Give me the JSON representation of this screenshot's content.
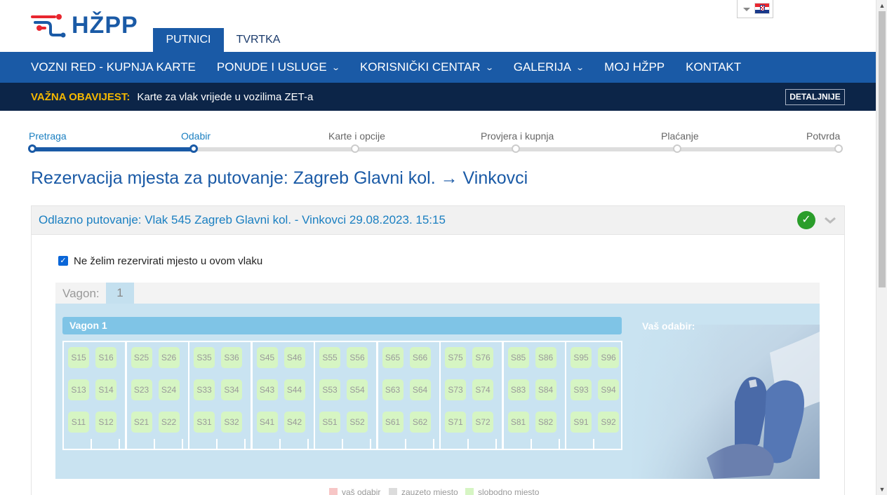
{
  "brand": {
    "logo_text": "HŽPP",
    "logo_icon": "train-track-logo-icon"
  },
  "top_tabs": [
    {
      "label": "PUTNICI",
      "active": true
    },
    {
      "label": "TVRTKA",
      "active": false
    }
  ],
  "language": {
    "flag": "croatia-flag-icon"
  },
  "nav": [
    {
      "label": "VOZNI RED - KUPNJA KARTE",
      "dropdown": false
    },
    {
      "label": "PONUDE I USLUGE",
      "dropdown": true
    },
    {
      "label": "KORISNIČKI CENTAR",
      "dropdown": true
    },
    {
      "label": "GALERIJA",
      "dropdown": true
    },
    {
      "label": "MOJ HŽPP",
      "dropdown": false
    },
    {
      "label": "KONTAKT",
      "dropdown": false
    }
  ],
  "notice": {
    "label": "VAŽNA OBAVIJEST:",
    "text": "Karte za vlak vrijede u vozilima ZET-a",
    "button": "DETALJNIJE"
  },
  "steps": [
    {
      "label": "Pretraga",
      "state": "done"
    },
    {
      "label": "Odabir",
      "state": "current"
    },
    {
      "label": "Karte i opcije",
      "state": "todo"
    },
    {
      "label": "Provjera i kupnja",
      "state": "todo"
    },
    {
      "label": "Plaćanje",
      "state": "todo"
    },
    {
      "label": "Potvrda",
      "state": "todo"
    }
  ],
  "page_title": "Rezervacija mjesta za putovanje: Zagreb Glavni kol. → Vinkovci",
  "journey": {
    "title": "Odlazno putovanje: Vlak 545 Zagreb Glavni kol. - Vinkovci 29.08.2023. 15:15",
    "status_icon": "check-circle-icon",
    "expand_icon": "chevron-down-icon"
  },
  "no_reservation": {
    "label": "Ne želim rezervirati mjesto u ovom vlaku",
    "checked": true
  },
  "wagon_tabs": {
    "label": "Vagon:",
    "tabs": [
      "1"
    ]
  },
  "wagon": {
    "title": "Vagon 1",
    "choice_label": "Vaš odabir:",
    "compartments": [
      {
        "rows": [
          [
            "S15",
            "S16"
          ],
          [
            "S13",
            "S14"
          ],
          [
            "S11",
            "S12"
          ]
        ]
      },
      {
        "rows": [
          [
            "S25",
            "S26"
          ],
          [
            "S23",
            "S24"
          ],
          [
            "S21",
            "S22"
          ]
        ]
      },
      {
        "rows": [
          [
            "S35",
            "S36"
          ],
          [
            "S33",
            "S34"
          ],
          [
            "S31",
            "S32"
          ]
        ]
      },
      {
        "rows": [
          [
            "S45",
            "S46"
          ],
          [
            "S43",
            "S44"
          ],
          [
            "S41",
            "S42"
          ]
        ]
      },
      {
        "rows": [
          [
            "S55",
            "S56"
          ],
          [
            "S53",
            "S54"
          ],
          [
            "S51",
            "S52"
          ]
        ]
      },
      {
        "rows": [
          [
            "S65",
            "S66"
          ],
          [
            "S63",
            "S64"
          ],
          [
            "S61",
            "S62"
          ]
        ]
      },
      {
        "rows": [
          [
            "S75",
            "S76"
          ],
          [
            "S73",
            "S74"
          ],
          [
            "S71",
            "S72"
          ]
        ]
      },
      {
        "rows": [
          [
            "S85",
            "S86"
          ],
          [
            "S83",
            "S84"
          ],
          [
            "S81",
            "S82"
          ]
        ]
      },
      {
        "rows": [
          [
            "S95",
            "S96"
          ],
          [
            "S93",
            "S94"
          ],
          [
            "S91",
            "S92"
          ]
        ]
      }
    ]
  },
  "legend": [
    {
      "label": "vaš odabir",
      "color": "#f7c6c6"
    },
    {
      "label": "zauzeto mjesto",
      "color": "#dcdcdc"
    },
    {
      "label": "slobodno mjesto",
      "color": "#d6f5c3"
    }
  ],
  "colors": {
    "primary": "#1a5aa6",
    "notice_bg": "#0c2548",
    "notice_label": "#f5b800",
    "seat_free": "#d6f5c3",
    "panel_bg": "#c9e3f1"
  }
}
